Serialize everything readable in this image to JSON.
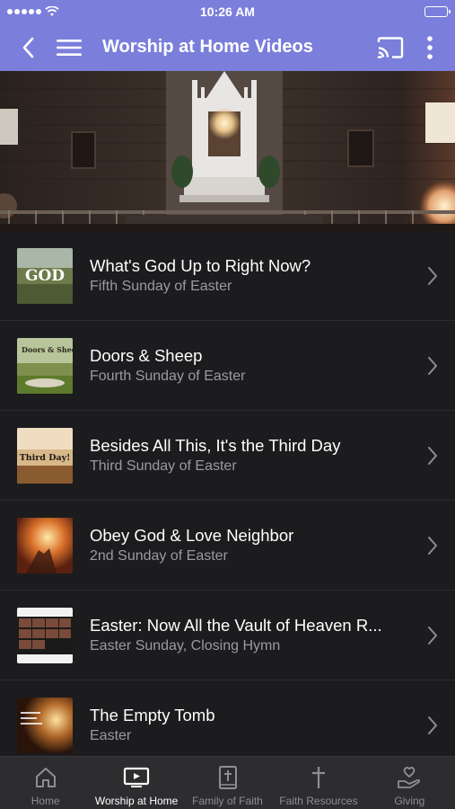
{
  "status_bar": {
    "time": "10:26 AM"
  },
  "app_bar": {
    "title": "Worship at Home Videos"
  },
  "videos": [
    {
      "title": "What's God Up to Right Now?",
      "subtitle": "Fifth Sunday of Easter",
      "thumb_text": "GOD"
    },
    {
      "title": "Doors & Sheep",
      "subtitle": "Fourth Sunday of Easter",
      "thumb_text": "Doors & Sheep"
    },
    {
      "title": "Besides All This, It's the Third Day",
      "subtitle": "Third Sunday of Easter",
      "thumb_text": "Third Day!"
    },
    {
      "title": "Obey God & Love Neighbor",
      "subtitle": "2nd Sunday of Easter",
      "thumb_text": ""
    },
    {
      "title": "Easter: Now All the Vault of Heaven R...",
      "subtitle": "Easter Sunday, Closing Hymn",
      "thumb_text": ""
    },
    {
      "title": "The Empty Tomb",
      "subtitle": "Easter",
      "thumb_text": ""
    }
  ],
  "tabs": [
    {
      "label": "Home",
      "icon": "home-icon",
      "active": false
    },
    {
      "label": "Worship at Home",
      "icon": "tv-icon",
      "active": true
    },
    {
      "label": "Family of Faith",
      "icon": "bible-icon",
      "active": false
    },
    {
      "label": "Faith Resources",
      "icon": "cross-icon",
      "active": false
    },
    {
      "label": "Giving",
      "icon": "giving-hand-icon",
      "active": false
    }
  ],
  "colors": {
    "header": "#7b7fdb",
    "background": "#1c1c1e",
    "tab_bar": "#2d2d30"
  }
}
